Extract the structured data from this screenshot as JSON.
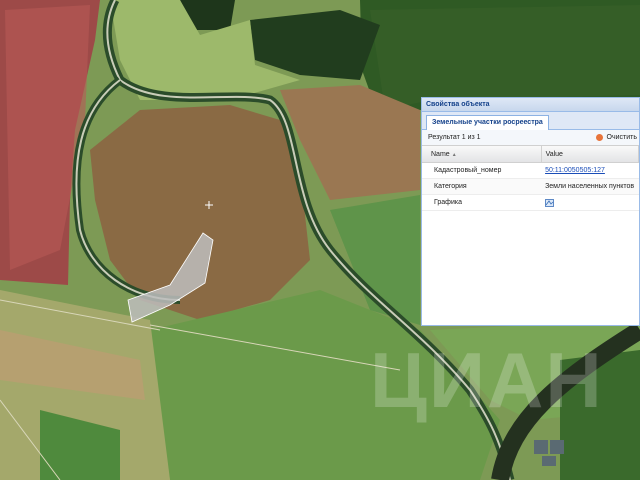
{
  "panel": {
    "title": "Свойства объекта",
    "tab_label": "Земельные участки росреестра",
    "result_text": "Результат 1 из 1",
    "clear_label": "Очистить",
    "columns": {
      "name": "Name",
      "value": "Value"
    },
    "rows": [
      {
        "name": "Кадастровый_номер",
        "value": "50:11:0050505:127"
      },
      {
        "name": "Категория",
        "value": "Земли населенных пунктов"
      },
      {
        "name": "Графика",
        "value": "graphic-icon"
      }
    ]
  },
  "watermark": "ЦИАН",
  "colors": {
    "accent": "#15428b",
    "panel_border": "#99bbe8",
    "link": "#1a4db8",
    "parcel": "#bdbdbd"
  }
}
